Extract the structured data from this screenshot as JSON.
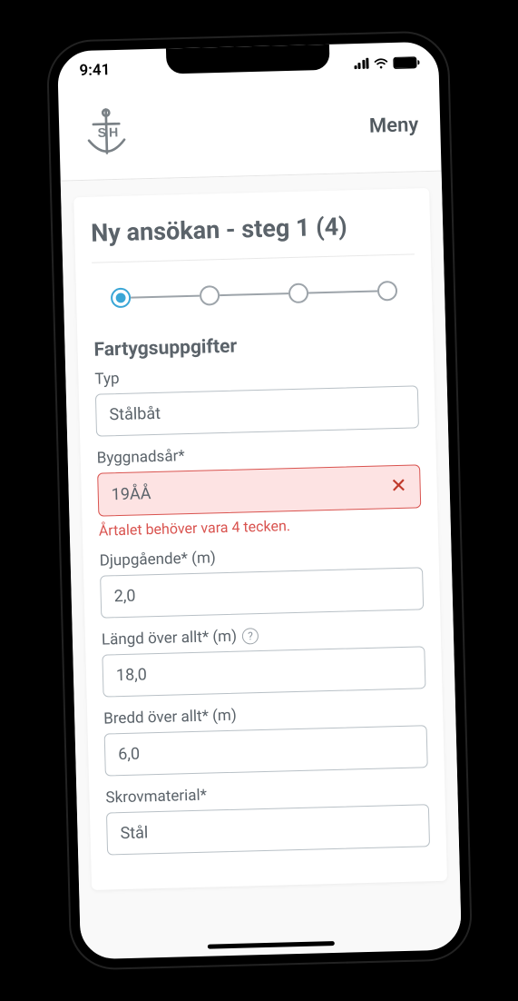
{
  "status": {
    "time": "9:41"
  },
  "header": {
    "menu": "Meny"
  },
  "page": {
    "title": "Ny ansökan - steg 1 (4)",
    "steps_total": 4,
    "current_step": 1,
    "section_title": "Fartygsuppgifter"
  },
  "fields": {
    "type": {
      "label": "Typ",
      "value": "Stålbåt"
    },
    "year": {
      "label": "Byggnadsår*",
      "value": "19ÅÅ",
      "error": "Årtalet behöver vara 4 tecken."
    },
    "draft": {
      "label": "Djupgående* (m)",
      "value": "2,0"
    },
    "length": {
      "label": "Längd över allt* (m)",
      "value": "18,0",
      "help": true
    },
    "beam": {
      "label": "Bredd över allt* (m)",
      "value": "6,0"
    },
    "hull": {
      "label": "Skrovmaterial*",
      "value": "Stål"
    }
  }
}
